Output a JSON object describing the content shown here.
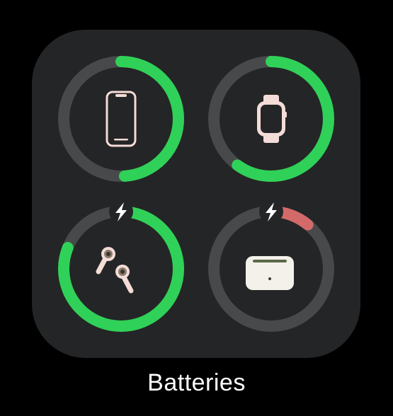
{
  "widget": {
    "title": "Batteries",
    "track_color": "#48494b",
    "background": "#242526"
  },
  "devices": [
    {
      "id": "iphone",
      "device_icon": "iphone-icon",
      "level": 0.49,
      "charging": false,
      "ring_color": "#30d158"
    },
    {
      "id": "apple-watch",
      "device_icon": "watch-icon",
      "level": 0.6,
      "charging": false,
      "ring_color": "#30d158"
    },
    {
      "id": "airpods",
      "device_icon": "airpods-icon",
      "level": 0.81,
      "charging": true,
      "ring_color": "#30d158"
    },
    {
      "id": "airpods-case",
      "device_icon": "airpods-case-icon",
      "level": 0.11,
      "charging": true,
      "ring_color": "#d36a6a"
    }
  ]
}
